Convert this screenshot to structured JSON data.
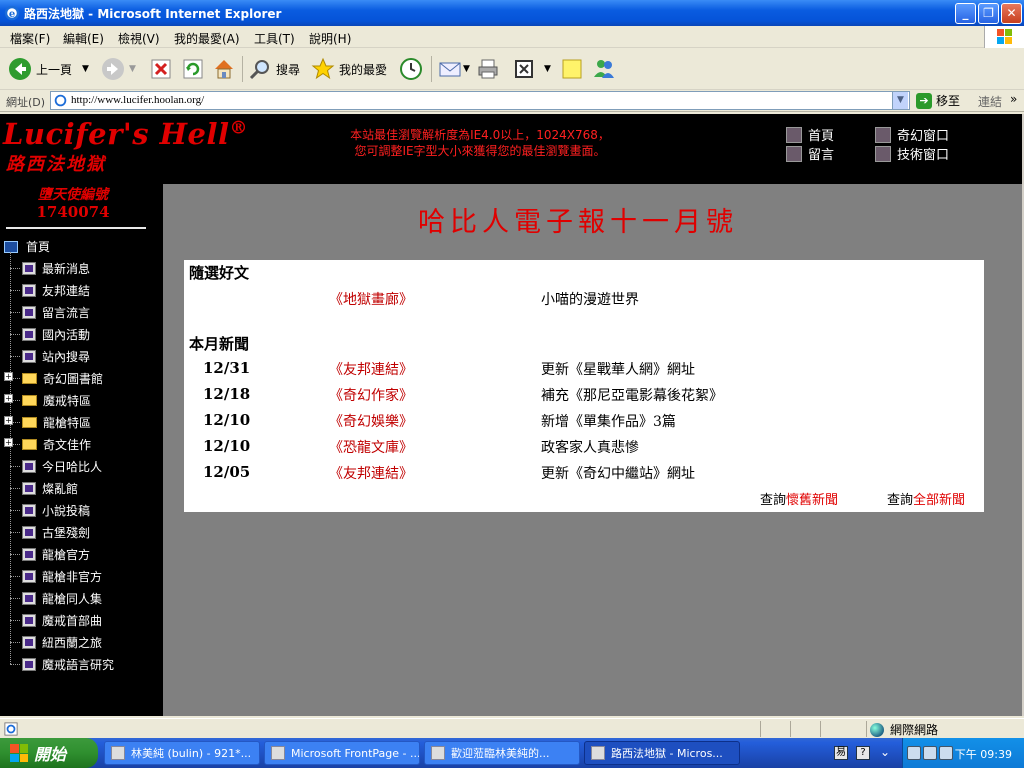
{
  "window": {
    "title": "路西法地獄 - Microsoft Internet Explorer"
  },
  "menu": [
    "檔案(F)",
    "編輯(E)",
    "檢視(V)",
    "我的最愛(A)",
    "工具(T)",
    "說明(H)"
  ],
  "toolbar": {
    "back": "上一頁",
    "search": "搜尋",
    "favorites": "我的最愛"
  },
  "address": {
    "label": "網址(D)",
    "url": "http://www.lucifer.hoolan.org/",
    "go": "移至",
    "links": "連結"
  },
  "site": {
    "logo": "Lucifer's Hell",
    "logo_mark": "®",
    "cn_title": "路西法地獄",
    "notice_line1": "本站最佳瀏覽解析度為IE4.0以上，1024X768，",
    "notice_line2": "您可調整IE字型大小來獲得您的最佳瀏覽畫面。",
    "toplinks": [
      "首頁",
      "奇幻窗口",
      "留言",
      "技術窗口"
    ],
    "angel_label": "墮天使編號",
    "angel_number": "1740074"
  },
  "tree": {
    "root": "首頁",
    "items": [
      {
        "label": "最新消息",
        "type": "book"
      },
      {
        "label": "友邦連結",
        "type": "book"
      },
      {
        "label": "留言流言",
        "type": "book"
      },
      {
        "label": "國內活動",
        "type": "book"
      },
      {
        "label": "站內搜尋",
        "type": "book"
      },
      {
        "label": "奇幻圖書館",
        "type": "folder"
      },
      {
        "label": "魔戒特區",
        "type": "folder"
      },
      {
        "label": "龍槍特區",
        "type": "folder"
      },
      {
        "label": "奇文佳作",
        "type": "folder"
      },
      {
        "label": "今日哈比人",
        "type": "book"
      },
      {
        "label": "燦亂館",
        "type": "book"
      },
      {
        "label": "小說投稿",
        "type": "book"
      },
      {
        "label": "古堡殘劍",
        "type": "book"
      },
      {
        "label": "龍槍官方",
        "type": "book"
      },
      {
        "label": "龍槍非官方",
        "type": "book"
      },
      {
        "label": "龍槍同人集",
        "type": "book"
      },
      {
        "label": "魔戒首部曲",
        "type": "book"
      },
      {
        "label": "紐西蘭之旅",
        "type": "book"
      },
      {
        "label": "魔戒語言研究",
        "type": "book"
      }
    ]
  },
  "newsletter": {
    "title": "哈比人電子報十一月號",
    "featured_heading": "隨選好文",
    "featured": {
      "category": "地獄畫廊",
      "desc": "小喵的漫遊世界"
    },
    "news_heading": "本月新聞",
    "news": [
      {
        "date": "12/31",
        "category": "友邦連結",
        "desc": "更新《星戰華人網》網址"
      },
      {
        "date": "12/18",
        "category": "奇幻作家",
        "desc": "補充《那尼亞電影幕後花絮》"
      },
      {
        "date": "12/10",
        "category": "奇幻娛樂",
        "desc": "新增《單集作品》3篇"
      },
      {
        "date": "12/10",
        "category": "恐龍文庫",
        "desc": "政客家人真悲慘"
      },
      {
        "date": "12/05",
        "category": "友邦連結",
        "desc": "更新《奇幻中繼站》網址"
      }
    ],
    "query_prefix": "查詢",
    "old_news": "懷舊新聞",
    "all_news": "全部新聞"
  },
  "statusbar": {
    "zone": "網際網路"
  },
  "taskbar": {
    "start": "開始",
    "tasks": [
      "林美純 (bulin) - 921*...",
      "Microsoft FrontPage - ...",
      "歡迎蒞臨林美純的...",
      "路西法地獄 - Micros..."
    ],
    "clock": "下午 09:39"
  },
  "colors": {
    "accent_red": "#e00000",
    "link_red": "#c00000",
    "panel_gray": "#808080"
  }
}
